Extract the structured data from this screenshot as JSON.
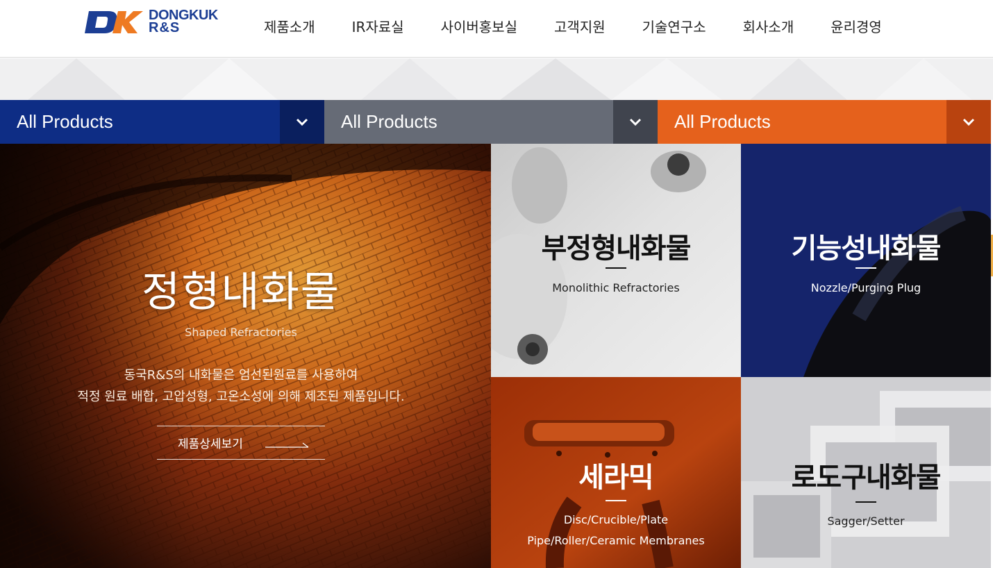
{
  "brand": {
    "logo_line1": "DONGKUK",
    "logo_line2": "R&S",
    "colors": {
      "navy": "#1c3e94",
      "orange": "#ee7a22"
    }
  },
  "nav": {
    "items": [
      {
        "label": "제품소개"
      },
      {
        "label": "IR자료실"
      },
      {
        "label": "사이버홍보실"
      },
      {
        "label": "고객지원"
      },
      {
        "label": "기술연구소"
      },
      {
        "label": "회사소개"
      },
      {
        "label": "윤리경영"
      }
    ]
  },
  "selects": [
    {
      "value": "All Products",
      "icon": "chevron-down-icon",
      "color": "#0e2d85"
    },
    {
      "value": "All Products",
      "icon": "chevron-down-icon",
      "color": "#666b76"
    },
    {
      "value": "All Products",
      "icon": "chevron-down-icon",
      "color": "#e5611c"
    }
  ],
  "featured": {
    "title": "정형내화물",
    "subtitle": "Shaped Refractories",
    "description_line1": "동국R&S의 내화물은 엄선된원료를 사용하여",
    "description_line2": "적정 원료 배합, 고압성형, 고온소성에 의해 제조된 제품입니다.",
    "link_label": "제품상세보기"
  },
  "tiles": [
    {
      "title": "부정형내화물",
      "subtitle_lines": [
        "Monolithic Refractories"
      ]
    },
    {
      "title": "기능성내화물",
      "subtitle_lines": [
        "Nozzle/Purging Plug"
      ]
    },
    {
      "title": "세라믹",
      "subtitle_lines": [
        "Disc/Crucible/Plate",
        "Pipe/Roller/Ceramic Membranes"
      ]
    },
    {
      "title": "로도구내화물",
      "subtitle_lines": [
        "Sagger/Setter"
      ]
    }
  ]
}
